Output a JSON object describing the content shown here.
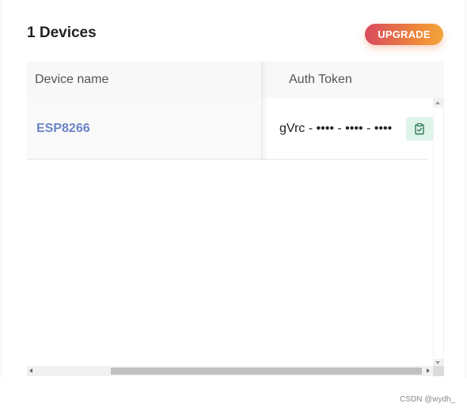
{
  "header": {
    "title": "1 Devices",
    "upgrade_label": "UPGRADE"
  },
  "table": {
    "columns": [
      "Device name",
      "Auth Token"
    ],
    "rows": [
      {
        "device_name": "ESP8266",
        "auth_token": "gVrc - •••• - •••• - ••••"
      }
    ]
  },
  "icons": {
    "copy": "clipboard-check-icon"
  },
  "watermark": "CSDN @wydh_",
  "colors": {
    "upgrade_gradient_start": "#d94a5e",
    "upgrade_gradient_end": "#f3a53b",
    "device_link": "#6b84c9",
    "copy_button_bg": "#def3ea",
    "copy_icon": "#2f7a5a"
  }
}
